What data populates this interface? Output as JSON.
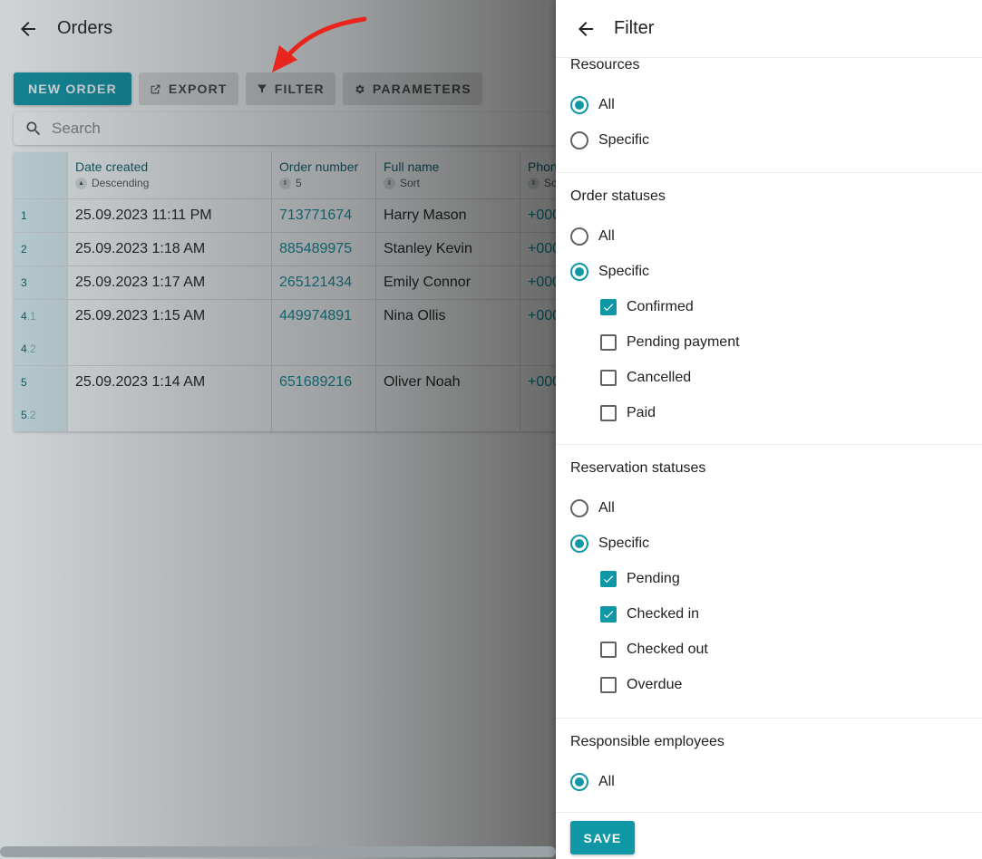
{
  "orders": {
    "title": "Orders",
    "toolbar": {
      "new_order": "NEW ORDER",
      "export": "EXPORT",
      "filter": "FILTER",
      "parameters": "PARAMETERS"
    },
    "search": {
      "placeholder": "Search"
    },
    "columns": [
      {
        "title": "Date created",
        "sort": "Descending"
      },
      {
        "title": "Order number",
        "sort": "5"
      },
      {
        "title": "Full name",
        "sort": "Sort"
      },
      {
        "title": "Phon",
        "sort": "So"
      }
    ],
    "rows": [
      {
        "index": "1",
        "date": "25.09.2023 11:11 PM",
        "number": "713771674",
        "name": "Harry Mason",
        "phone": "+000"
      },
      {
        "index": "2",
        "date": "25.09.2023 1:18 AM",
        "number": "885489975",
        "name": "Stanley Kevin",
        "phone": "+000"
      },
      {
        "index": "3",
        "date": "25.09.2023 1:17 AM",
        "number": "265121434",
        "name": "Emily Connor",
        "phone": "+000"
      },
      {
        "index": "4",
        "sub1": ".1",
        "sub2": ".2",
        "date": "25.09.2023 1:15 AM",
        "number": "449974891",
        "name": "Nina Ollis",
        "phone": "+000"
      },
      {
        "index": "5",
        "sub2": ".2",
        "date": "25.09.2023 1:14 AM",
        "number": "651689216",
        "name": "Oliver Noah",
        "phone": "+000"
      }
    ]
  },
  "filter": {
    "title": "Filter",
    "resources": {
      "title": "Resources",
      "options": [
        "All",
        "Specific"
      ],
      "selected": 0
    },
    "order_statuses": {
      "title": "Order statuses",
      "options": [
        "All",
        "Specific"
      ],
      "selected": 1,
      "items": [
        {
          "label": "Confirmed",
          "checked": true
        },
        {
          "label": "Pending payment",
          "checked": false
        },
        {
          "label": "Cancelled",
          "checked": false
        },
        {
          "label": "Paid",
          "checked": false
        }
      ]
    },
    "reservation_statuses": {
      "title": "Reservation statuses",
      "options": [
        "All",
        "Specific"
      ],
      "selected": 1,
      "items": [
        {
          "label": "Pending",
          "checked": true
        },
        {
          "label": "Checked in",
          "checked": true
        },
        {
          "label": "Checked out",
          "checked": false
        },
        {
          "label": "Overdue",
          "checked": false
        }
      ]
    },
    "responsible_employees": {
      "title": "Responsible employees",
      "options": [
        "All"
      ],
      "selected": 0
    },
    "save_label": "SAVE"
  },
  "colors": {
    "accent": "#0f97a6",
    "link": "#0f8f9d",
    "header_text": "#0b5f68",
    "annotation_arrow": "#e8241d"
  },
  "icons": {
    "back": "arrow-left-icon",
    "export": "share-icon",
    "filter": "funnel-icon",
    "parameters": "gear-icon",
    "search": "search-icon"
  }
}
